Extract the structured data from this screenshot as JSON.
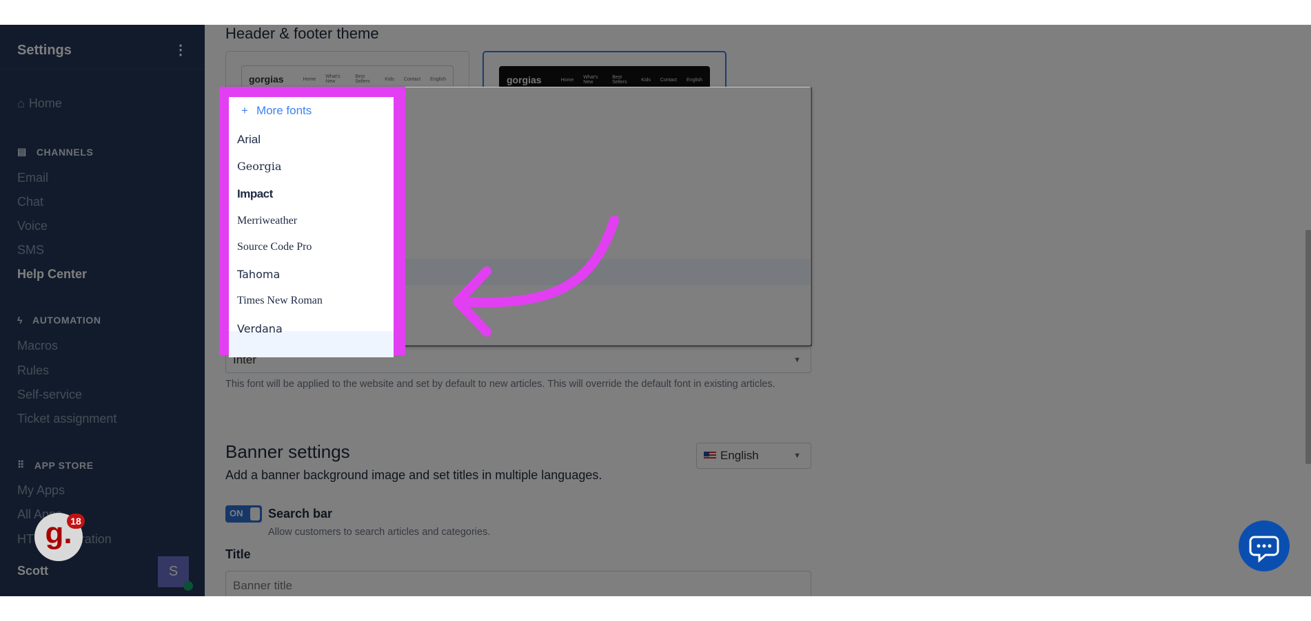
{
  "sidebar": {
    "title": "Settings",
    "home": "Home",
    "sections": [
      {
        "label": "CHANNELS",
        "icon": "chat-icon",
        "items": [
          "Email",
          "Chat",
          "Voice",
          "SMS",
          "Help Center"
        ]
      },
      {
        "label": "AUTOMATION",
        "icon": "bolt-icon",
        "items": [
          "Macros",
          "Rules",
          "Self-service",
          "Ticket assignment"
        ]
      },
      {
        "label": "APP STORE",
        "icon": "grid-icon",
        "items": [
          "My Apps",
          "All Apps",
          "HTTP Integration"
        ]
      }
    ],
    "active_item": "Help Center",
    "user": {
      "name": "Scott",
      "avatar_initial": "S",
      "status_color": "#1aa06d"
    }
  },
  "main": {
    "header_footer_title": "Header & footer theme",
    "theme_preview": {
      "logo": "gorgias",
      "nav": [
        "Home",
        "What's New",
        "Best Sellers",
        "Kids",
        "Contact",
        "English"
      ]
    },
    "font_select": {
      "value": "Inter",
      "help": "This font will be applied to the website and set by default to new articles. This will override the default font in existing articles."
    },
    "font_dropdown": {
      "more_fonts": "More fonts",
      "options": [
        "Arial",
        "Georgia",
        "Impact",
        "Merriweather",
        "Source Code Pro",
        "Tahoma",
        "Times New Roman",
        "Verdana"
      ],
      "hovered": "Tahoma"
    },
    "banner": {
      "title": "Banner settings",
      "subtitle": "Add a banner background image and set titles in multiple languages.",
      "language": "English",
      "search_toggle": {
        "state": "ON",
        "label": "Search bar",
        "help": "Allow customers to search articles and categories."
      },
      "title_label": "Title",
      "title_placeholder": "Banner title"
    }
  },
  "widgets": {
    "gorgias_badge_count": "18",
    "gorgias_letter": "g."
  },
  "colors": {
    "highlight": "#e23ff2",
    "accent": "#1f6fd6",
    "sidebar": "#233757"
  }
}
